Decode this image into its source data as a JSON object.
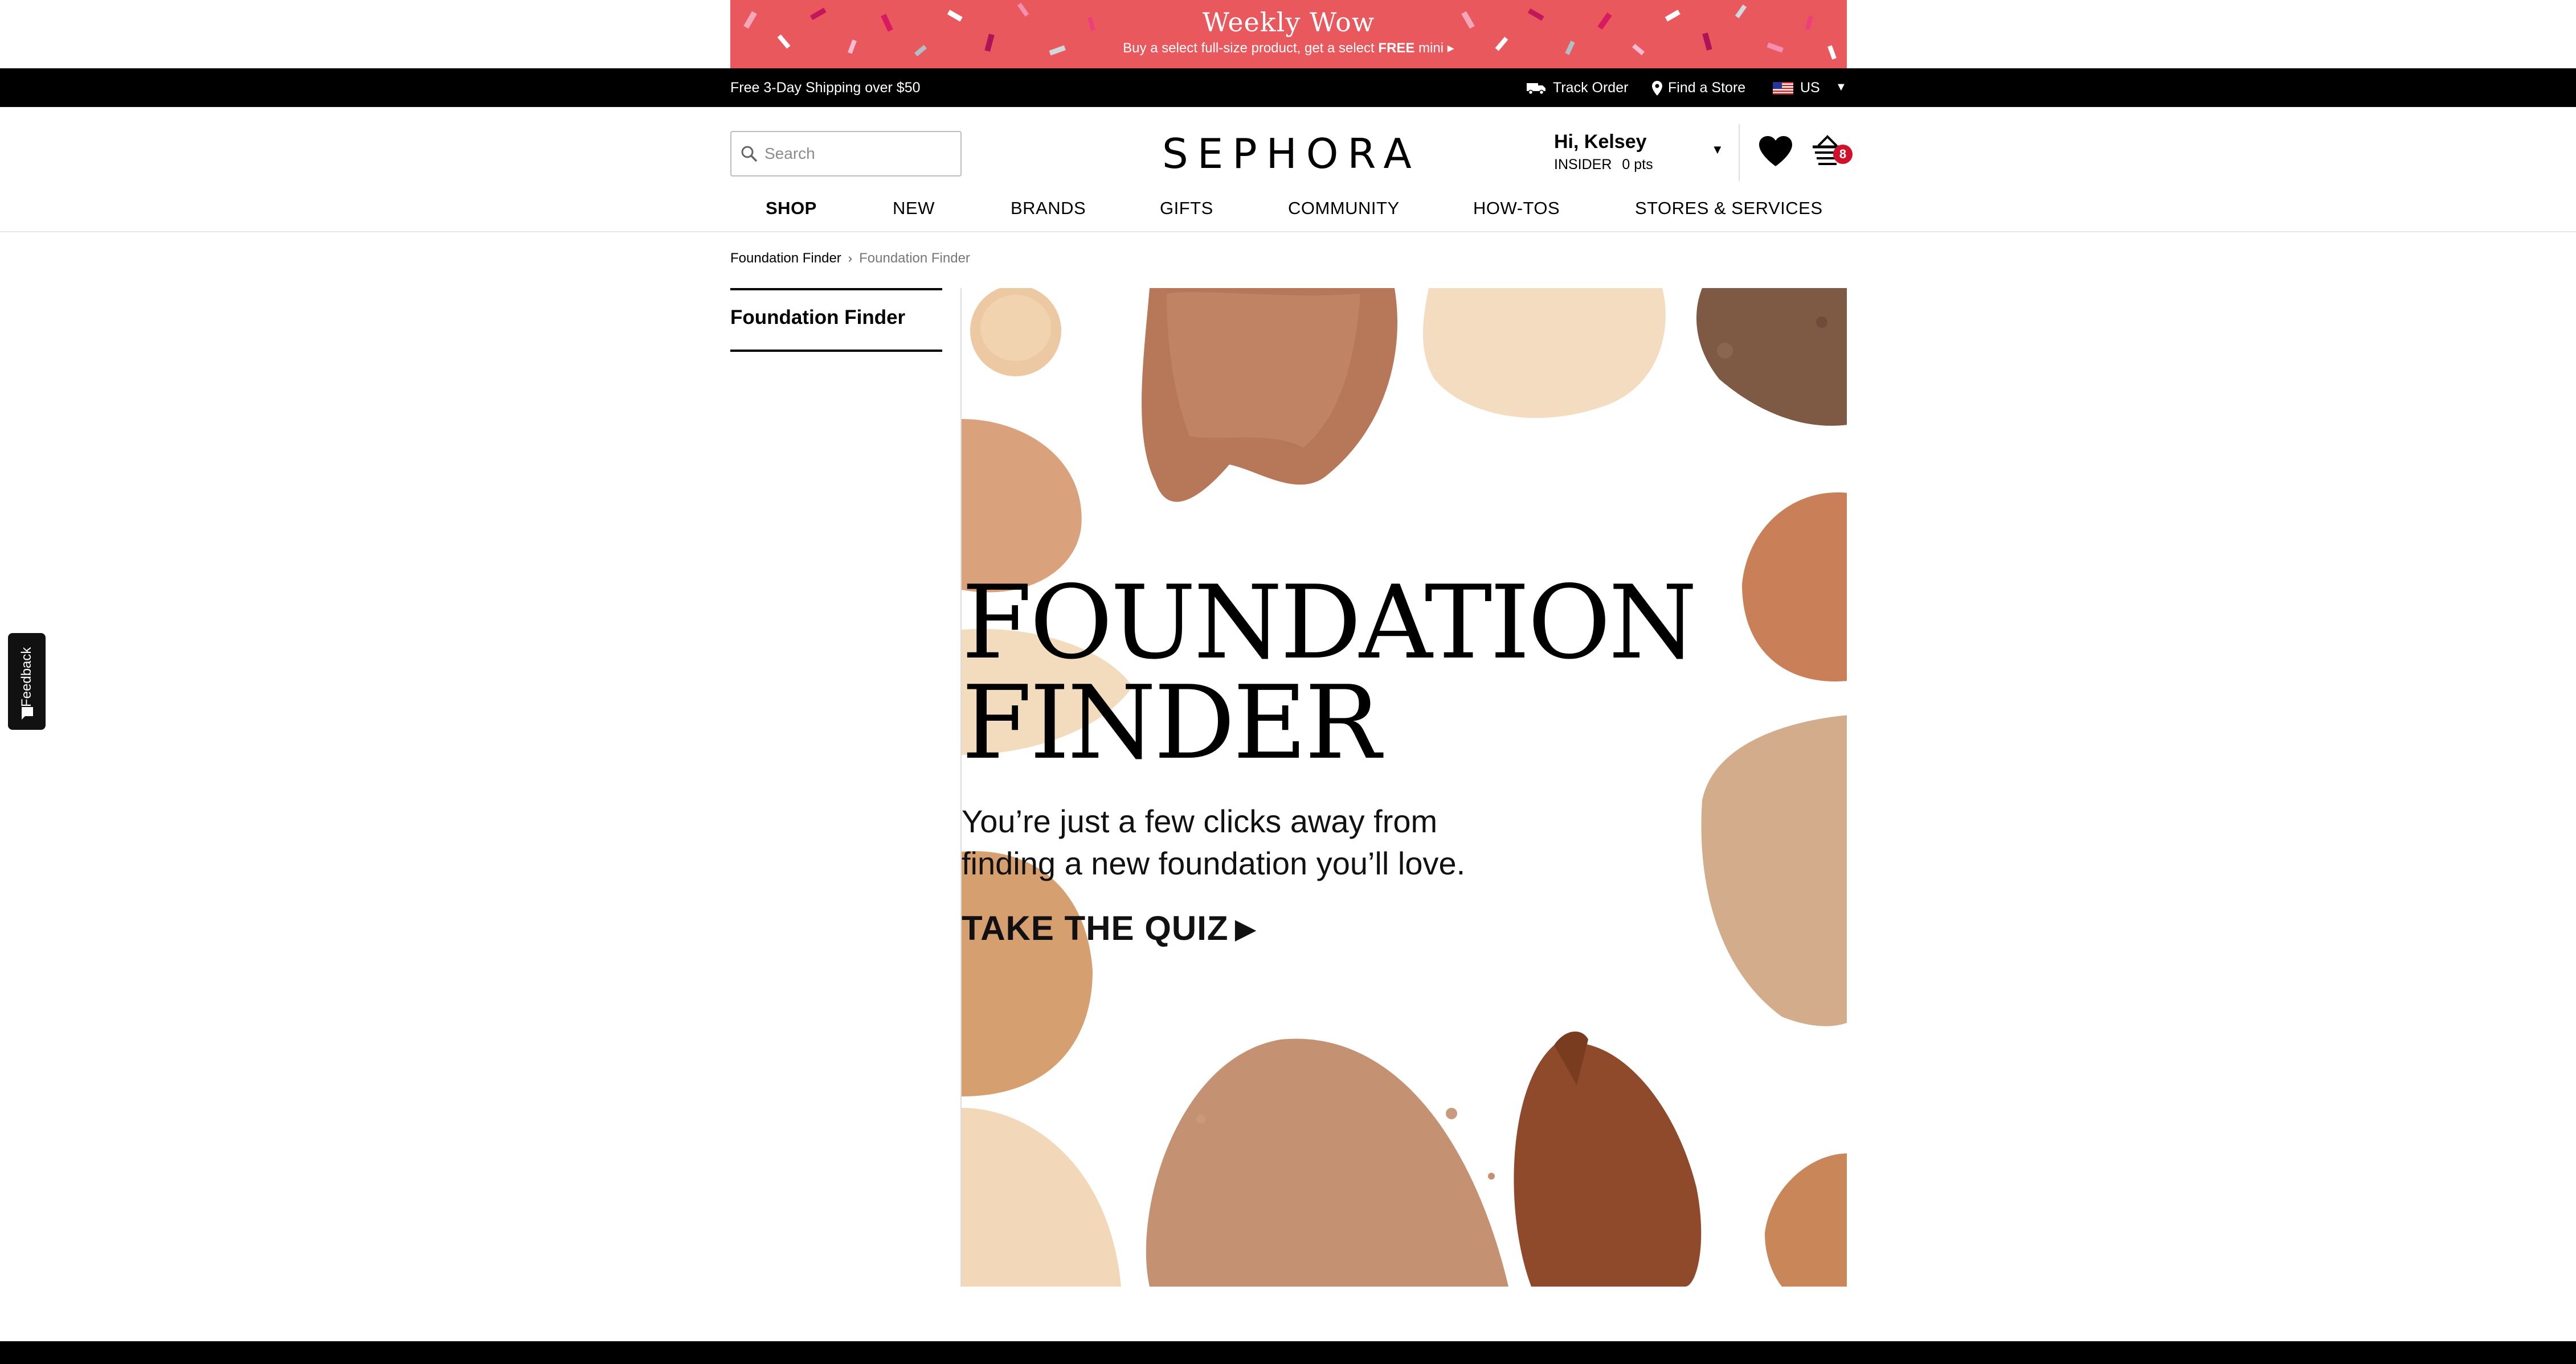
{
  "promo": {
    "title": "Weekly Wow",
    "subtitle_pre": "Buy a select full-size product, get a select",
    "subtitle_bold": "FREE",
    "subtitle_post": "mini",
    "arrow": "▸",
    "background_color": "#e8585c"
  },
  "topbar": {
    "shipping": "Free 3-Day Shipping over $50",
    "track_order": "Track Order",
    "find_store": "Find a Store",
    "country": "US",
    "caret": "▼"
  },
  "header": {
    "search_placeholder": "Search",
    "logo": "SEPHORA",
    "greeting": "Hi, Kelsey",
    "tier": "INSIDER",
    "points": "0 pts",
    "account_caret": "▼",
    "basket_count": "8",
    "basket_badge_color": "#cf112c"
  },
  "nav": {
    "items": [
      {
        "label": "SHOP",
        "active": true
      },
      {
        "label": "NEW"
      },
      {
        "label": "BRANDS"
      },
      {
        "label": "GIFTS"
      },
      {
        "label": "COMMUNITY"
      },
      {
        "label": "HOW-TOS"
      },
      {
        "label": "STORES & SERVICES"
      }
    ]
  },
  "breadcrumb": {
    "parent": "Foundation Finder",
    "separator": "›",
    "current": "Foundation Finder"
  },
  "sidenav": {
    "title": "Foundation Finder"
  },
  "hero": {
    "title_line1": "FOUNDATION",
    "title_line2": "FINDER",
    "subtitle_line1": "You’re just a few clicks away from",
    "subtitle_line2": "finding a new foundation you’ll love.",
    "cta": "TAKE THE QUIZ",
    "cta_arrow": "▶"
  },
  "feedback": {
    "label": "Feedback"
  },
  "icons": {
    "search": "search-icon",
    "truck": "truck-icon",
    "pin": "map-pin-icon",
    "flag": "us-flag-icon",
    "heart": "heart-icon",
    "basket": "basket-icon",
    "feedback": "chat-icon"
  }
}
